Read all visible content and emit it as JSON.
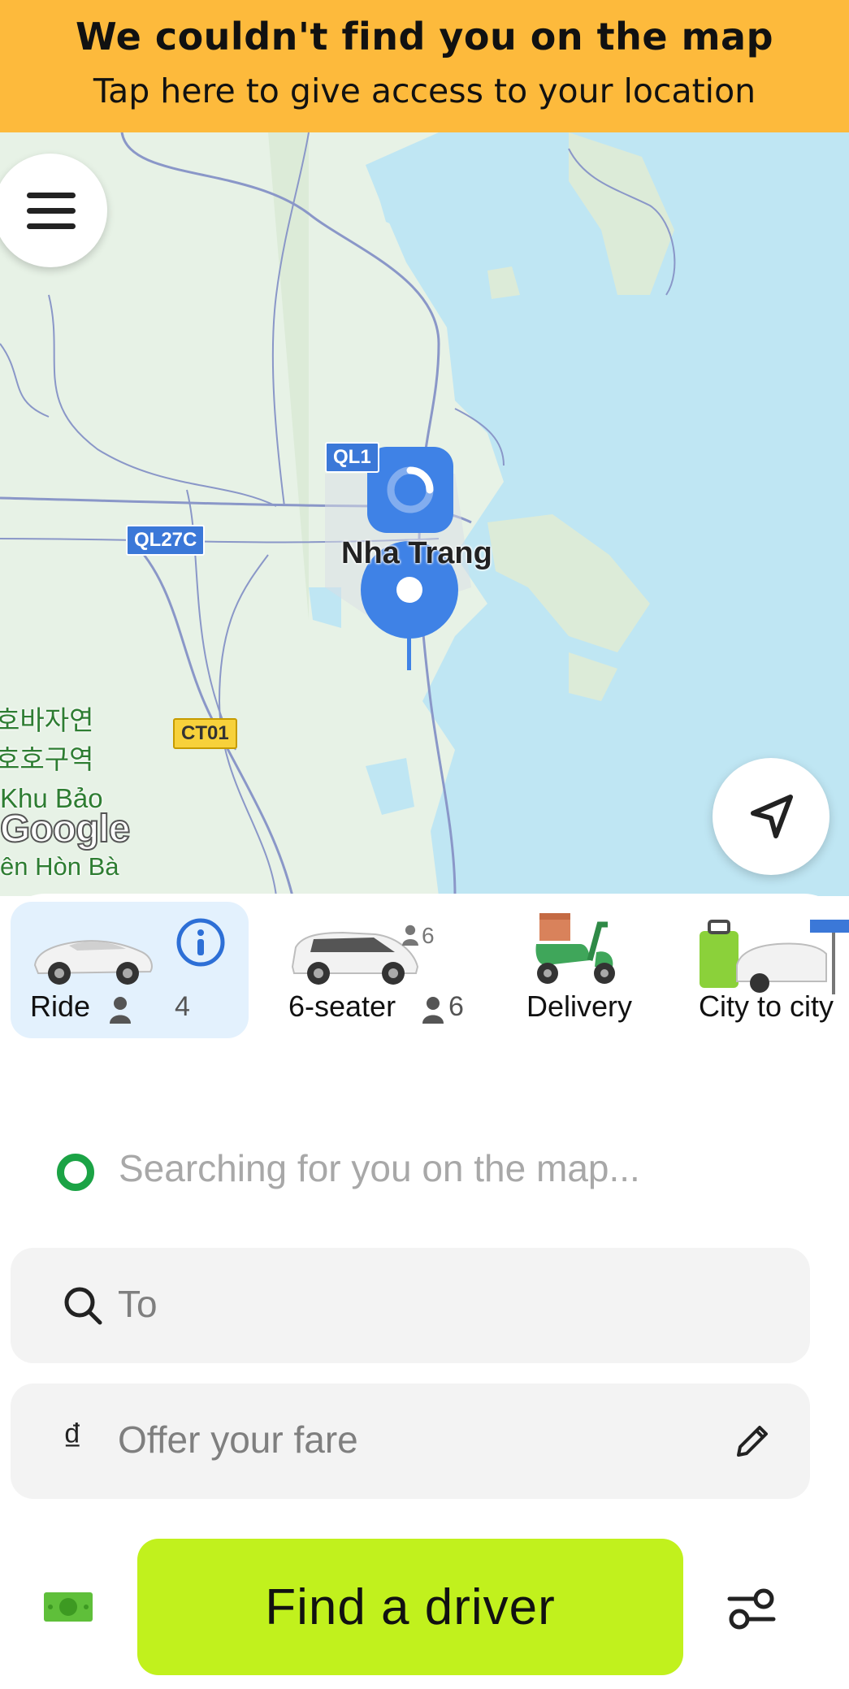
{
  "banner": {
    "title": "We couldn't find you on the map",
    "subtitle": "Tap here to give access to your location"
  },
  "map": {
    "road_labels": [
      "QL1",
      "QL27C",
      "CT01"
    ],
    "city_label": "Nha Trang",
    "park_label_lines": [
      "호바자연",
      "호호구역",
      "Khu Bảo",
      "ên Hòn Bà"
    ],
    "attribution": "Google",
    "colors": {
      "water": "#bfe6f3",
      "land": "#e7f2e6",
      "pin": "#3f82e6",
      "road": "#8a97c8"
    }
  },
  "services": [
    {
      "label": "Ride",
      "capacity": "4",
      "selected": true,
      "icon": "sedan-car-icon"
    },
    {
      "label": "6-seater",
      "capacity": "6",
      "badge": "6",
      "selected": false,
      "icon": "minivan-icon"
    },
    {
      "label": "Delivery",
      "selected": false,
      "icon": "scooter-icon"
    },
    {
      "label": "City to city",
      "selected": false,
      "icon": "luggage-car-icon"
    }
  ],
  "pickup": {
    "placeholder": "Searching for you on the map..."
  },
  "destination": {
    "placeholder": "To"
  },
  "fare": {
    "currency_symbol": "₫",
    "placeholder": "Offer your fare"
  },
  "actions": {
    "find_driver_label": "Find a driver"
  },
  "colors": {
    "banner": "#FDBA3C",
    "accent": "#C1F11D",
    "selected_service_bg": "#e3f1fd",
    "pickup_dot": "#1ba345"
  }
}
